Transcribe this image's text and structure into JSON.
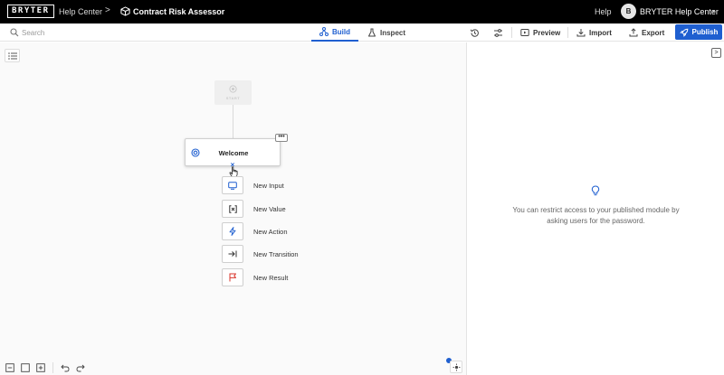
{
  "header": {
    "logo": "BRYTER",
    "breadcrumb_parent": "Help Center",
    "breadcrumb_separator": ">",
    "module_title": "Contract Risk Assessor",
    "help_label": "Help",
    "avatar_initial": "B",
    "org_name": "BRYTER Help Center",
    "org_caret": "▾"
  },
  "toolbar": {
    "search_placeholder": "Search",
    "tabs": [
      {
        "label": "Build",
        "active": true
      },
      {
        "label": "Inspect",
        "active": false
      }
    ],
    "preview_label": "Preview",
    "import_label": "Import",
    "export_label": "Export",
    "publish_label": "Publish"
  },
  "canvas": {
    "start_label": "START",
    "welcome_node_label": "Welcome",
    "more_label": "•••",
    "close_label": "×",
    "add_items": [
      {
        "label": "New Input",
        "icon": "input-icon"
      },
      {
        "label": "New Value",
        "icon": "value-icon"
      },
      {
        "label": "New Action",
        "icon": "action-icon"
      },
      {
        "label": "New Transition",
        "icon": "transition-icon"
      },
      {
        "label": "New Result",
        "icon": "result-flag-icon"
      }
    ]
  },
  "panel": {
    "toggle_label": ">",
    "message": "You can restrict access to your published module by asking users for the password."
  },
  "colors": {
    "accent": "#1f5fd0",
    "topbar": "#000000",
    "result_flag": "#d9342b"
  }
}
